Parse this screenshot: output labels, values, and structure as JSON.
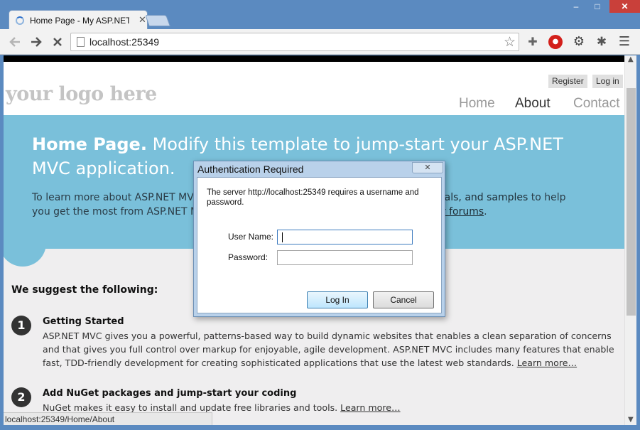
{
  "browser": {
    "tab_title": "Home Page - My ASP.NET",
    "tab_close": "✕",
    "url": "localhost:25349",
    "window_controls": {
      "minimize": "‒",
      "maximize": "□",
      "close": "✕"
    },
    "status_url": "localhost:25349/Home/About"
  },
  "site": {
    "logo": "your logo here",
    "register": "Register",
    "login": "Log in",
    "nav": [
      "Home",
      "About",
      "Contact"
    ]
  },
  "featured": {
    "title_bold": "Home Page.",
    "title_rest": " Modify this template to jump-start your ASP.NET MVC application.",
    "line1_start": "To learn more about ASP.NET MVC",
    "line1_link": "tutorials, and samples",
    "line1_end": " to help",
    "line2_start": "you get the most from ASP.NET MVC",
    "line2_link": "our forums",
    "line2_end": "."
  },
  "suggest": {
    "heading": "We suggest the following:",
    "items": [
      {
        "num": "1",
        "title": "Getting Started",
        "body": "ASP.NET MVC gives you a powerful, patterns-based way to build dynamic websites that enables a clean separation of concerns and that gives you full control over markup for enjoyable, agile development. ASP.NET MVC includes many features that enable fast, TDD-friendly development for creating sophisticated applications that use the latest web standards. ",
        "link": "Learn more…"
      },
      {
        "num": "2",
        "title": "Add NuGet packages and jump-start your coding",
        "body": "NuGet makes it easy to install and update free libraries and tools. ",
        "link": "Learn more…"
      }
    ]
  },
  "dialog": {
    "title": "Authentication Required",
    "message": "The server http://localhost:25349 requires a username and password.",
    "username_label": "User Name:",
    "password_label": "Password:",
    "username_value": "",
    "password_value": "",
    "login_button": "Log In",
    "cancel_button": "Cancel",
    "close": "✕"
  },
  "icons": {
    "back": "back-arrow-icon",
    "forward": "forward-arrow-icon",
    "stop": "stop-loading-icon",
    "bookmark": "star-icon",
    "extensions": [
      "puzzle-icon",
      "stop-sign-icon",
      "gear-icon",
      "bug-icon",
      "menu-icon"
    ]
  }
}
